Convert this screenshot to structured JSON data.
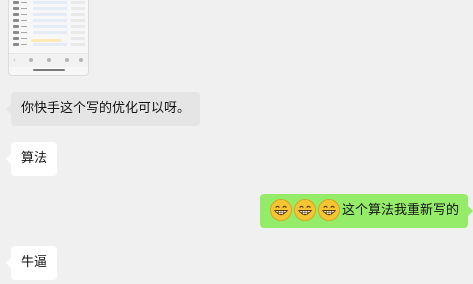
{
  "chat": {
    "messages": [
      {
        "from": "other",
        "type": "image",
        "content": "screenshot"
      },
      {
        "from": "other",
        "type": "text",
        "text": "你快手这个写的优化可以呀。"
      },
      {
        "from": "other",
        "type": "text",
        "text": "算法"
      },
      {
        "from": "self",
        "type": "text",
        "emoji_icon": "grinning-face-icon",
        "emoji_count": 3,
        "text": "这个算法我重新写的"
      },
      {
        "from": "other",
        "type": "text",
        "text": "牛逼"
      }
    ]
  },
  "colors": {
    "background": "#f0f0f0",
    "incoming_bubble": "#ffffff",
    "incoming_bubble_selected": "#e5e5e5",
    "outgoing_bubble": "#95ec69",
    "text": "#111111"
  }
}
